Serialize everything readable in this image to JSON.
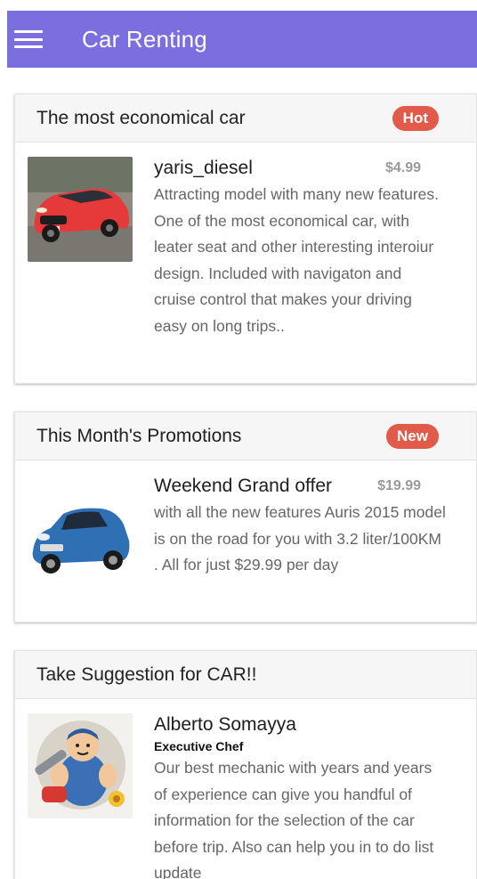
{
  "app": {
    "title": "Car Renting"
  },
  "icons": {
    "menu": "hamburger-icon"
  },
  "colors": {
    "appbar": "#7b6fe0",
    "badge": "#e25a4a"
  },
  "cards": [
    {
      "title": "The most economical car",
      "badge": "Hot",
      "item": {
        "name": "yaris_diesel",
        "price": "$4.99",
        "description": "Attracting model with many new features. One of the most economical car, with leater seat and other interesting interoiur design. Included with navigaton and cruise control that makes your driving easy on long trips.."
      }
    },
    {
      "title": "This Month's Promotions",
      "badge": "New",
      "item": {
        "name": "Weekend Grand offer",
        "price": "$19.99",
        "description": "with all the new features Auris 2015 model is on the road for you with 3.2 liter/100KM . All for just $29.99 per day"
      }
    },
    {
      "title": "Take Suggestion for CAR!!",
      "item": {
        "name": "Alberto Somayya",
        "subtitle": "Executive Chef",
        "description": "Our best mechanic with years and years of experience can give you handful of information for the selection of the car before trip. Also can help you in to do list update"
      }
    }
  ]
}
